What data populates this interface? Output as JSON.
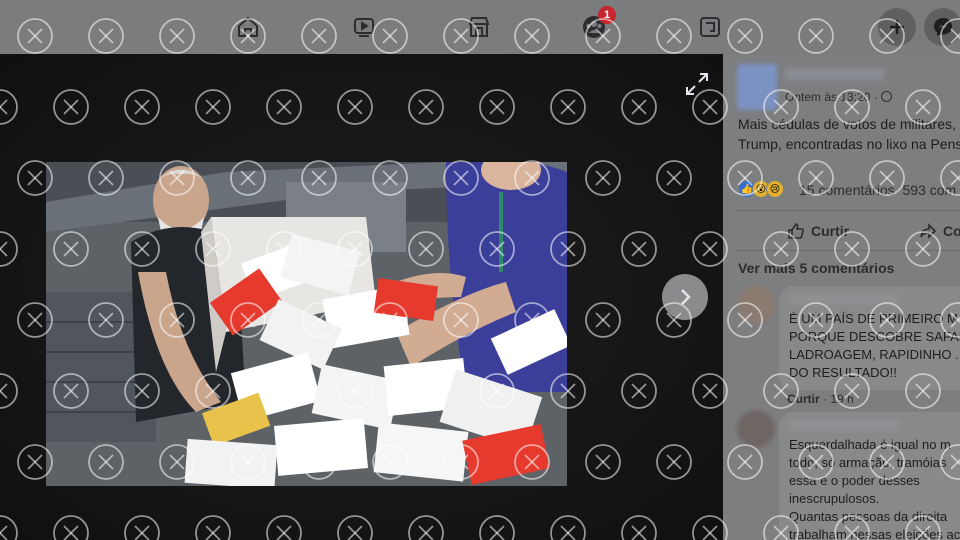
{
  "nav": {
    "items": [
      {
        "name": "home",
        "icon": "home-icon"
      },
      {
        "name": "watch",
        "icon": "video-icon"
      },
      {
        "name": "marketplace",
        "icon": "marketplace-icon"
      },
      {
        "name": "groups",
        "icon": "groups-icon",
        "badge": "1"
      },
      {
        "name": "gaming",
        "icon": "gaming-icon"
      }
    ],
    "create_icon": "plus-icon",
    "messenger_icon": "messenger-icon"
  },
  "post": {
    "timestamp": "Ontem às 13:20 ·",
    "text_lines": [
      "Mais cédulas de votos de militares,",
      "Trump, encontradas no lixo na Pens"
    ],
    "reaction_icons": [
      "like",
      "wow",
      "sad"
    ],
    "comments_count": "15 comentários",
    "shares_count": "593 com",
    "actions": {
      "like": "Curtir",
      "comment": "Comentar"
    },
    "more_comments": "Ver mais 5 comentários"
  },
  "comments": [
    {
      "lines": [
        "É UM PAÍS DE PRIMEIRO M",
        "PORQUE DESCOBRE SAFAD",
        "LADROAGEM, RAPIDINHO .",
        "DO RESULTADO!!"
      ],
      "like_label": "Curtir",
      "time": "19 h"
    },
    {
      "lines": [
        "Esquerdalhada é igual no m",
        "todo, só armação, tramóias",
        "essa é o poder desses",
        "inescrupulosos.",
        "Quantas pessoas da direita",
        "trabalham nessas eleições ac"
      ]
    }
  ],
  "colors": {
    "topbar": "#7b7c7e",
    "panel": "#7d7e80",
    "viewer": "#141414",
    "badge": "#c8262f",
    "watermark": "#ffffff"
  }
}
